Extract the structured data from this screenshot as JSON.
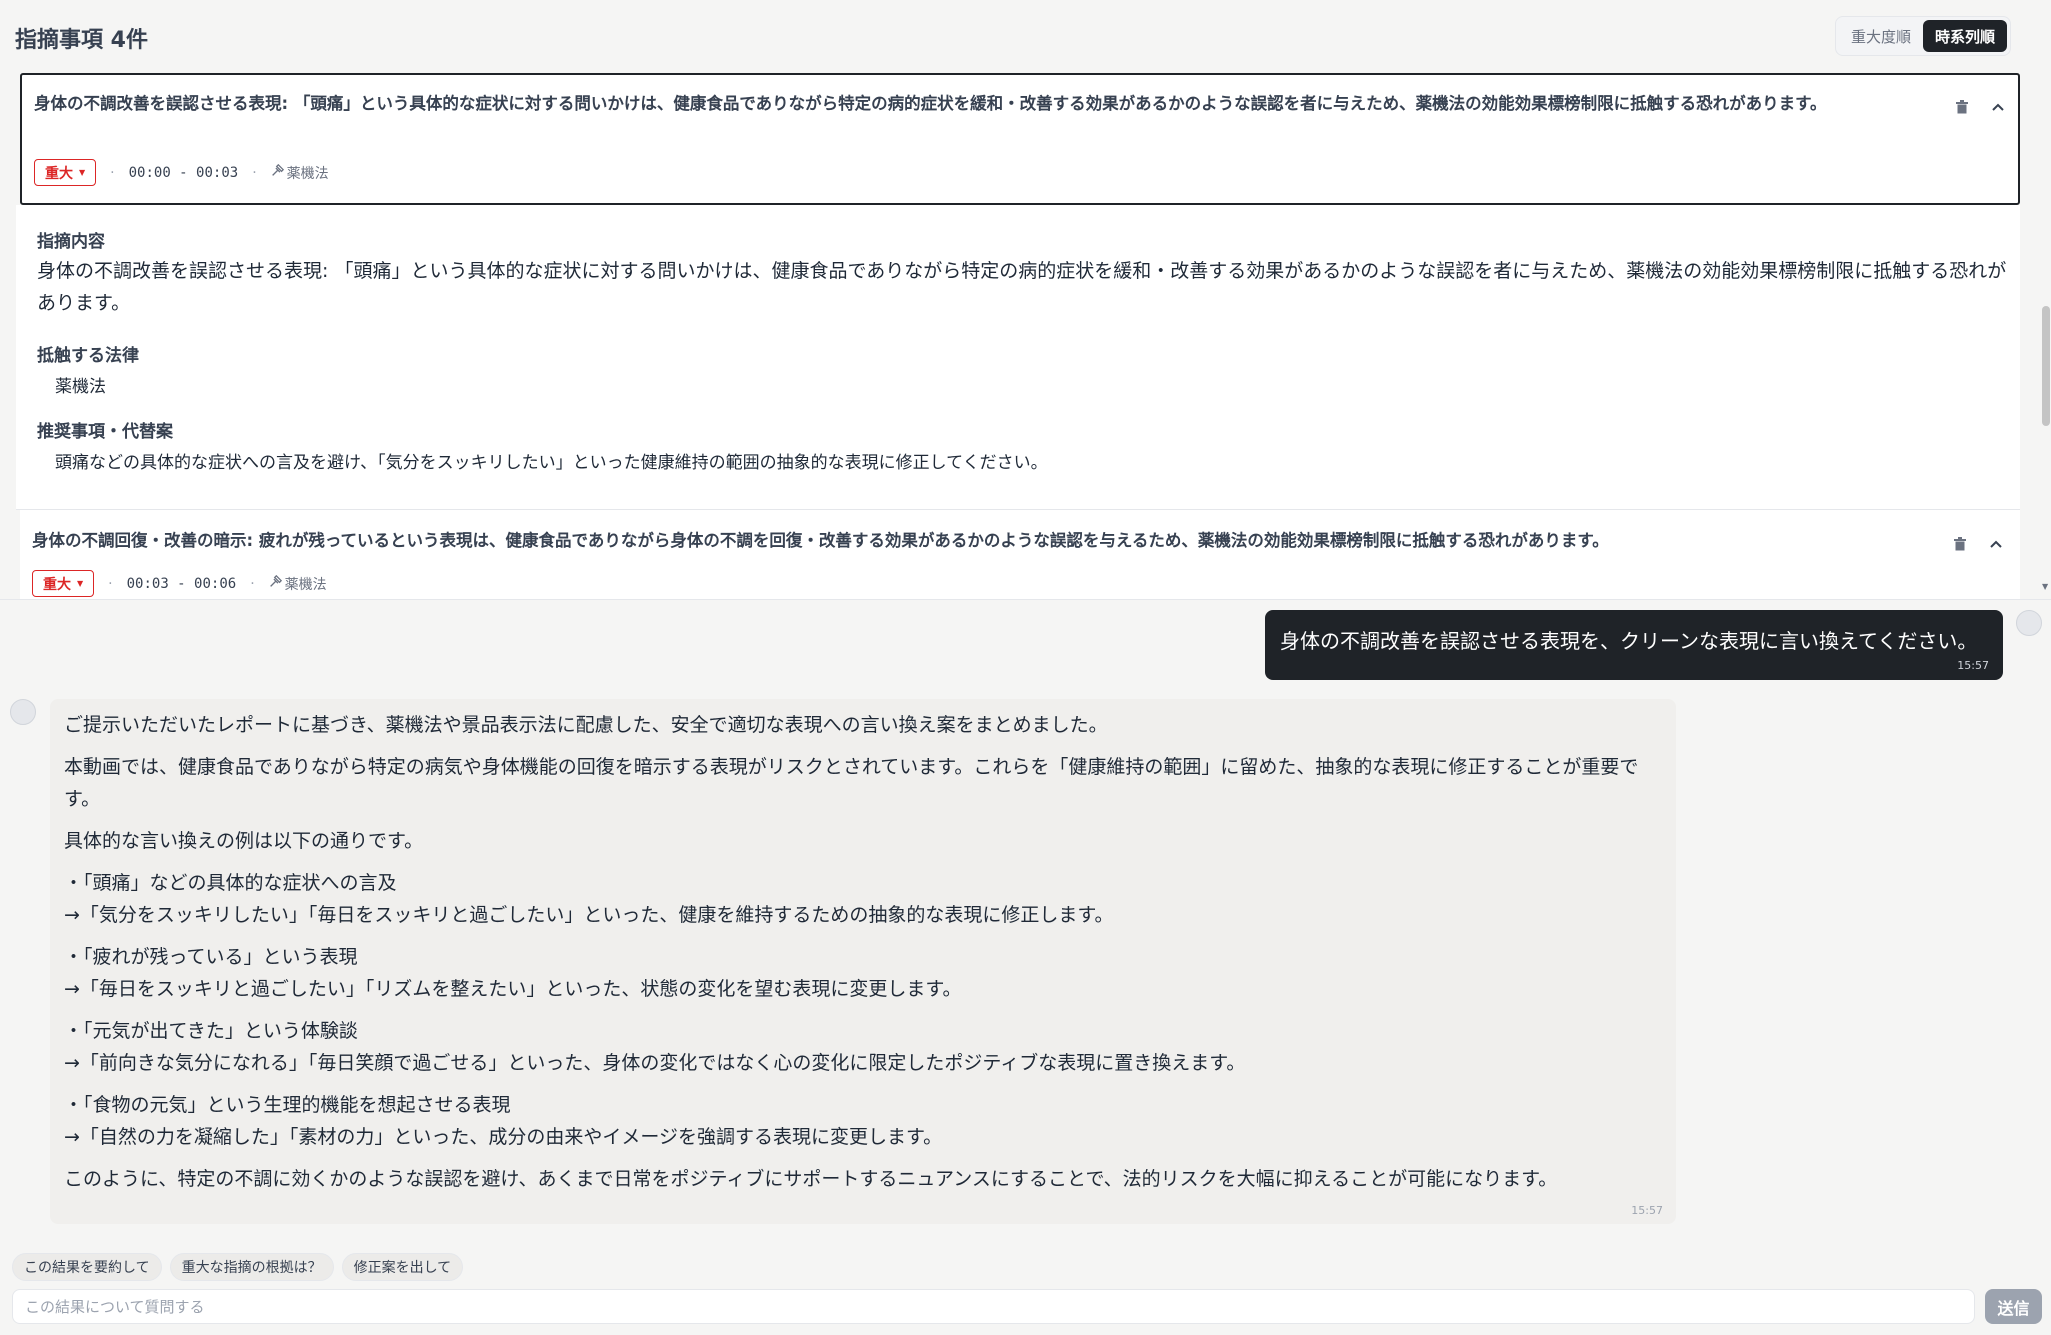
{
  "panel": {
    "title": "指摘事項 4件",
    "sort_options": [
      "重大度順",
      "時系列順"
    ],
    "active_sort": "時系列順"
  },
  "issues": [
    {
      "title": "身体の不調改善を誤認させる表現: 「頭痛」という具体的な症状に対する問いかけは、健康食品でありながら特定の病的症状を緩和・改善する効果があるかのような誤認を者に与えため、薬機法の効能効果標榜制限に抵触する恐れがあります。",
      "severity": "重大",
      "time": "00:00 - 00:03",
      "law": "薬機法",
      "detail": {
        "content_label": "指摘内容",
        "content": "身体の不調改善を誤認させる表現: 「頭痛」という具体的な症状に対する問いかけは、健康食品でありながら特定の病的症状を緩和・改善する効果があるかのような誤認を者に与えため、薬機法の効能効果標榜制限に抵触する恐れがあります。",
        "law_label": "抵触する法律",
        "law": "薬機法",
        "recommend_label": "推奨事項・代替案",
        "recommend": "頭痛などの具体的な症状への言及を避け、「気分をスッキリしたい」といった健康維持の範囲の抽象的な表現に修正してください。"
      }
    },
    {
      "title": "身体の不調回復・改善の暗示: 疲れが残っているという表現は、健康食品でありながら身体の不調を回復・改善する効果があるかのような誤認を与えるため、薬機法の効能効果標榜制限に抵触する恐れがあります。",
      "severity": "重大",
      "time": "00:03 - 00:06",
      "law": "薬機法"
    }
  ],
  "chat": {
    "user_message": {
      "text": "身体の不調改善を誤認させる表現を、クリーンな表現に言い換えてください。",
      "time": "15:57"
    },
    "ai_message": {
      "paragraphs": [
        "ご提示いただいたレポートに基づき、薬機法や景品表示法に配慮した、安全で適切な表現への言い換え案をまとめました。",
        "本動画では、健康食品でありながら特定の病気や身体機能の回復を暗示する表現がリスクとされています。これらを「健康維持の範囲」に留めた、抽象的な表現に修正することが重要です。",
        "具体的な言い換えの例は以下の通りです。",
        "・「頭痛」などの具体的な症状への言及",
        "→「気分をスッキリしたい」「毎日をスッキリと過ごしたい」といった、健康を維持するための抽象的な表現に修正します。",
        "・「疲れが残っている」という表現",
        "→「毎日をスッキリと過ごしたい」「リズムを整えたい」といった、状態の変化を望む表現に変更します。",
        "・「元気が出てきた」という体験談",
        "→「前向きな気分になれる」「毎日笑顔で過ごせる」といった、身体の変化ではなく心の変化に限定したポジティブな表現に置き換えます。",
        "・「食物の元気」という生理的機能を想起させる表現",
        "→「自然の力を凝縮した」「素材の力」といった、成分の由来やイメージを強調する表現に変更します。",
        "このように、特定の不調に効くかのような誤認を避け、あくまで日常をポジティブにサポートするニュアンスにすることで、法的リスクを大幅に抑えることが可能になります。"
      ],
      "time": "15:57"
    }
  },
  "suggestions": [
    "この結果を要約して",
    "重大な指摘の根拠は？",
    "修正案を出して"
  ],
  "input": {
    "placeholder": "この結果について質問する",
    "value": ""
  },
  "send_label": "送信",
  "colors": {
    "severity_red": "#dc2626",
    "dark": "#1f2328",
    "send_disabled": "#9ca3af"
  },
  "icons": {
    "delete": "trash-icon",
    "collapse": "chevron-up-icon",
    "law": "gavel-icon",
    "severity_dropdown": "caret-down-icon"
  }
}
